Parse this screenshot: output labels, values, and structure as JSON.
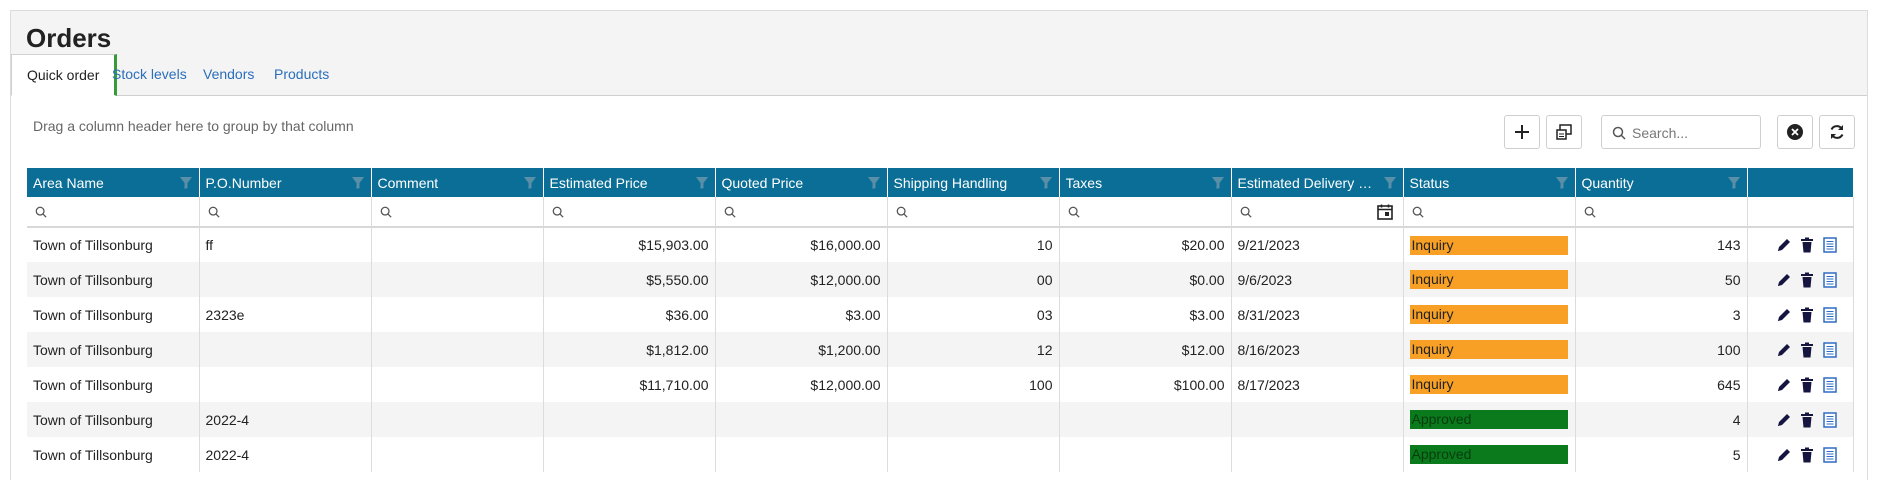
{
  "page": {
    "title": "Orders"
  },
  "tabs": [
    {
      "label": "Quick order",
      "active": true
    },
    {
      "label": "Stock levels",
      "active": false
    },
    {
      "label": "Vendors",
      "active": false
    },
    {
      "label": "Products",
      "active": false
    }
  ],
  "toolbar": {
    "group_hint": "Drag a column header here to group by that column",
    "search_placeholder": "Search...",
    "icons": [
      "plus-icon",
      "export-icon",
      "search-icon",
      "clear-icon",
      "refresh-icon"
    ]
  },
  "grid": {
    "columns": [
      "Area Name",
      "P.O.Number",
      "Comment",
      "Estimated Price",
      "Quoted Price",
      "Shipping Handling",
      "Taxes",
      "Estimated Delivery …",
      "Status",
      "Quantity",
      ""
    ],
    "rows": [
      {
        "area": "Town of Tillsonburg",
        "po": "ff",
        "comment": "",
        "est_price": "$15,903.00",
        "quoted_price": "$16,000.00",
        "shipping": "10",
        "taxes": "$20.00",
        "delivery": "9/21/2023",
        "status": "Inquiry",
        "quantity": "143"
      },
      {
        "area": "Town of Tillsonburg",
        "po": "",
        "comment": "",
        "est_price": "$5,550.00",
        "quoted_price": "$12,000.00",
        "shipping": "00",
        "taxes": "$0.00",
        "delivery": "9/6/2023",
        "status": "Inquiry",
        "quantity": "50"
      },
      {
        "area": "Town of Tillsonburg",
        "po": "2323e",
        "comment": "",
        "est_price": "$36.00",
        "quoted_price": "$3.00",
        "shipping": "03",
        "taxes": "$3.00",
        "delivery": "8/31/2023",
        "status": "Inquiry",
        "quantity": "3"
      },
      {
        "area": "Town of Tillsonburg",
        "po": "",
        "comment": "",
        "est_price": "$1,812.00",
        "quoted_price": "$1,200.00",
        "shipping": "12",
        "taxes": "$12.00",
        "delivery": "8/16/2023",
        "status": "Inquiry",
        "quantity": "100"
      },
      {
        "area": "Town of Tillsonburg",
        "po": "",
        "comment": "",
        "est_price": "$11,710.00",
        "quoted_price": "$12,000.00",
        "shipping": "100",
        "taxes": "$100.00",
        "delivery": "8/17/2023",
        "status": "Inquiry",
        "quantity": "645"
      },
      {
        "area": "Town of Tillsonburg",
        "po": "2022-4",
        "comment": "",
        "est_price": "",
        "quoted_price": "",
        "shipping": "",
        "taxes": "",
        "delivery": "",
        "status": "Approved",
        "quantity": "4"
      },
      {
        "area": "Town of Tillsonburg",
        "po": "2022-4",
        "comment": "",
        "est_price": "",
        "quoted_price": "",
        "shipping": "",
        "taxes": "",
        "delivery": "",
        "status": "Approved",
        "quantity": "5"
      }
    ]
  },
  "colors": {
    "header_bg": "#0a6e96",
    "inquiry": "#f7a025",
    "approved": "#0a7a1c",
    "link": "#2a6ebb",
    "active_tab_accent": "#3a9a3a"
  }
}
